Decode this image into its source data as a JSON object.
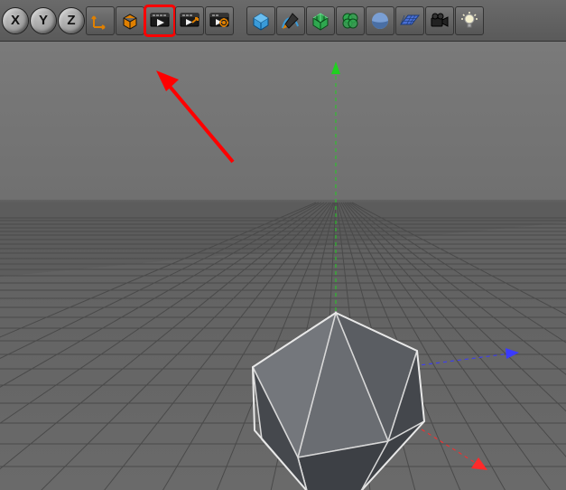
{
  "toolbar": {
    "axis_x": "X",
    "axis_y": "Y",
    "axis_z": "Z"
  },
  "icons": {
    "axis_arrow": "axis-arrow-icon",
    "cube": "cube-icon",
    "render_view": "render-view-icon",
    "render_region": "render-region-icon",
    "render_picture": "render-picture-viewer-icon",
    "primitive": "primitive-cube-icon",
    "spline": "spline-pen-icon",
    "generator": "generator-icon",
    "deformer": "deformer-icon",
    "environment": "environment-sky-icon",
    "floor": "floor-icon",
    "camera": "camera-icon",
    "light": "light-icon"
  },
  "annotation": {
    "highlight_target": "render-view-button"
  }
}
